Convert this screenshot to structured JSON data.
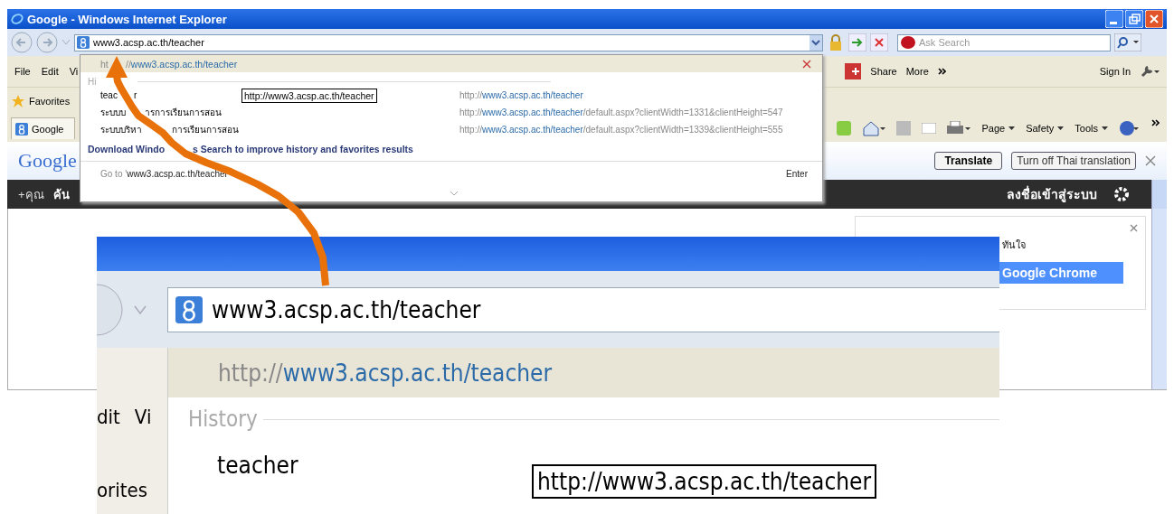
{
  "window": {
    "title": "Google - Windows Internet Explorer"
  },
  "address_bar": {
    "value": "www3.acsp.ac.th/teacher"
  },
  "search_box": {
    "placeholder": "Ask Search"
  },
  "command_bar": {
    "menus": [
      "File",
      "Edit",
      "Vi"
    ],
    "share": "Share",
    "more": "More",
    "sign_in": "Sign In"
  },
  "favorites_bar": {
    "label": "Favorites"
  },
  "tabs": [
    {
      "label": "Google",
      "selected": true
    }
  ],
  "page_tools": [
    "Page",
    "Safety",
    "Tools"
  ],
  "translate_bar": {
    "logo": "Google",
    "buttons": [
      "Translate",
      "Turn off Thai translation"
    ]
  },
  "google_bar": {
    "items": [
      "+คุณ",
      "ค้น"
    ],
    "sign_in": "ลงชื่อเข้าสู่ระบบ"
  },
  "promo_card": {
    "text": "ทันใจ",
    "button": "Google Chrome"
  },
  "dropdown": {
    "suggestion": {
      "prefix_parts": [
        "ht",
        "//"
      ],
      "host": "www3.acsp.ac.th/teacher"
    },
    "history_label": "Hi",
    "history": [
      {
        "title_parts": [
          "teac",
          "r"
        ],
        "prefix": "http://",
        "host": "www3.acsp.ac.th/teacher"
      },
      {
        "title_parts": [
          "ระบบบ",
          "ารการเรียนการสอน"
        ],
        "prefix": "http://",
        "host": "www3.acsp.ac.th/teacher",
        "rest": "/default.aspx?clientWidth=1331&clientHeight=547"
      },
      {
        "title_parts": [
          "ระบบบริหา",
          "การเรียนการสอน"
        ],
        "prefix": "http://",
        "host": "www3.acsp.ac.th/teacher",
        "rest": "/default.aspx?clientWidth=1339&clientHeight=555"
      }
    ],
    "tooltip": "http://www3.acsp.ac.th/teacher",
    "download_link_parts": [
      "Download Windo",
      "s Search to improve history and favorites results"
    ],
    "go_to_label": "Go to '",
    "go_to_value": "www3.acsp.ac.th/teacher",
    "enter": "Enter"
  },
  "zoom_inset": {
    "address_value": "www3.acsp.ac.th/teacher",
    "suggestion": {
      "prefix": "http://",
      "host": "www3.acsp.ac.th/teacher"
    },
    "menu_fragments": [
      "dit",
      "Vi"
    ],
    "history_label": "History",
    "history_item": "teacher",
    "tooltip": "http://www3.acsp.ac.th/teacher",
    "favorites_fragment": "orites"
  }
}
